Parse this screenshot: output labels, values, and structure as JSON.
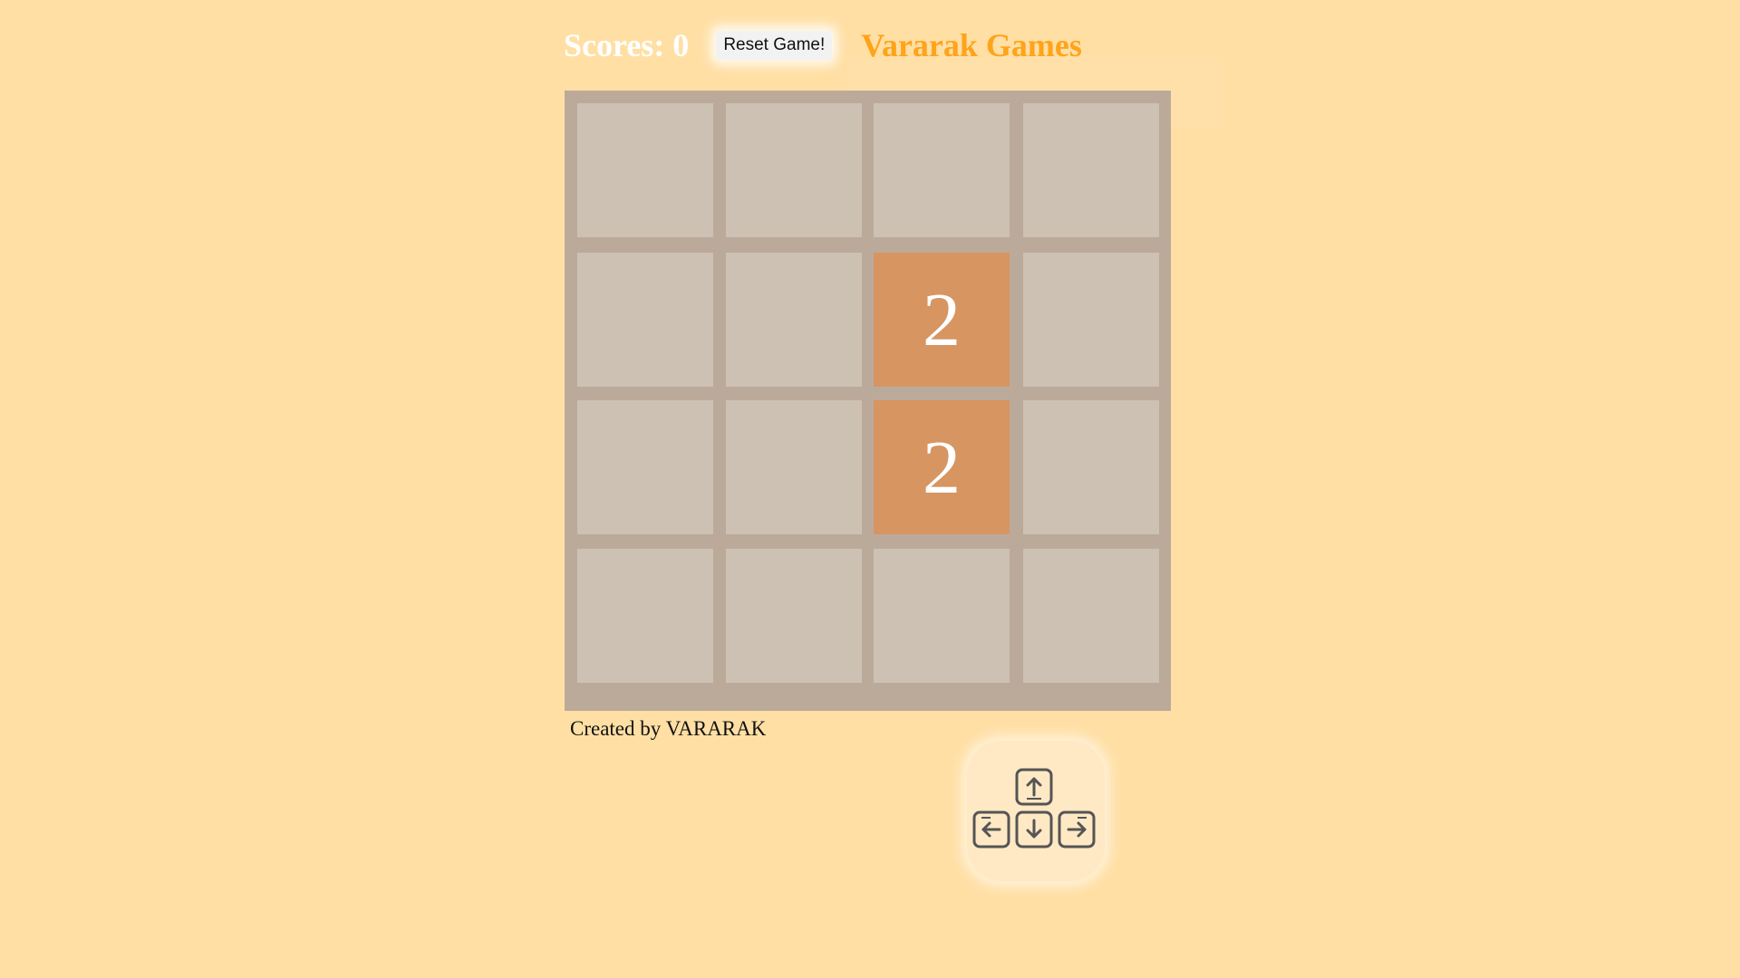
{
  "header": {
    "score_label": "Scores: 0",
    "reset_label": "Reset Game!",
    "brand": "Vararak Games"
  },
  "board": {
    "rows": [
      [
        "",
        "",
        "",
        ""
      ],
      [
        "",
        "",
        "2",
        ""
      ],
      [
        "",
        "",
        "2",
        ""
      ],
      [
        "",
        "",
        "",
        ""
      ]
    ]
  },
  "footer": {
    "credit": "Created by VARARAK"
  },
  "controls": {
    "keys": [
      "arrow-up-key",
      "arrow-left-key",
      "arrow-down-key",
      "arrow-right-key"
    ]
  },
  "colors": {
    "background": "#ffdfa4",
    "board": "#bbaa9a",
    "empty_tile": "#cdc1b3",
    "tile_2": "#d69561",
    "brand": "#ffa31a"
  }
}
